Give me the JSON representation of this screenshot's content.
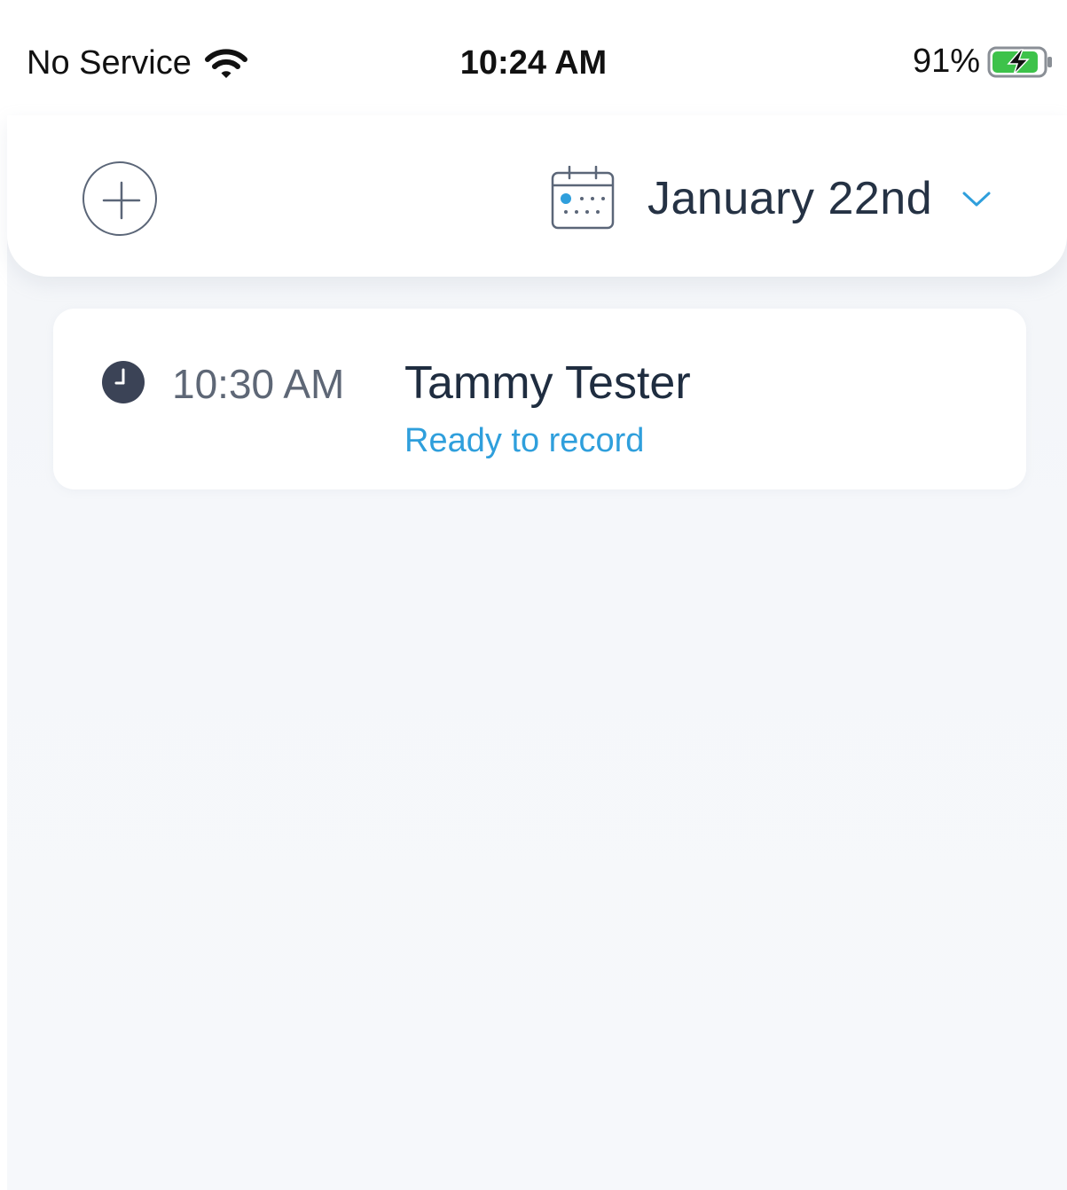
{
  "status_bar": {
    "carrier": "No Service",
    "time": "10:24 AM",
    "battery_percent": "91%",
    "battery_level": 0.91,
    "battery_charging": true
  },
  "header": {
    "add_icon": "plus-circle-icon",
    "calendar_icon": "calendar-icon",
    "date_label": "January 22nd",
    "chevron_icon": "chevron-down-icon"
  },
  "appointments": [
    {
      "time": "10:30 AM",
      "name": "Tammy Tester",
      "status": "Ready to record",
      "icon": "clock-icon"
    }
  ],
  "colors": {
    "accent": "#2f9fdc",
    "title_text": "#1f2d40",
    "muted_text": "#5e6776",
    "battery_green": "#3dc24a",
    "background": "#f5f7fa"
  }
}
